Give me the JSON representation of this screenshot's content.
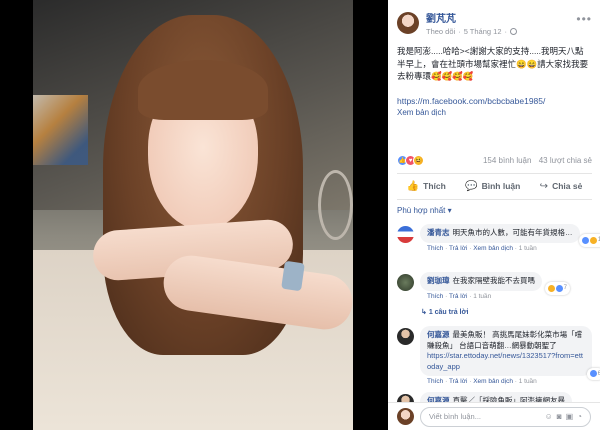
{
  "post": {
    "author": "劉芃芃",
    "follow": "Theo dõi",
    "date": "5 Tháng 12",
    "caption": "我是阿澎.....哈哈><謝謝大家的支持.....我明天八點半早上，會在社頭市場幫家裡忙😄😄請大家找我要去粉專環🥰🥰🥰🥰",
    "link": "https://m.facebook.com/bcbcbabe1985/",
    "see_translation": "Xem bản dịch",
    "comment_count": "154 bình luận",
    "share_count": "43 lượt chia sẻ"
  },
  "actions": {
    "like": "Thích",
    "comment": "Bình luận",
    "share": "Chia sẻ"
  },
  "filter": "Phù hợp nhất ▾",
  "comments": [
    {
      "name": "潘青志",
      "text": "明天魚市的人數，可能有年貨規格…",
      "like": "Thích",
      "reply": "Trả lời",
      "translate": "Xem bản dịch",
      "time": "1 tuần",
      "reactions": "12"
    },
    {
      "name": "劉珈瑋",
      "text": "在我家隔壁我能不去買嗎",
      "like": "Thích",
      "reply": "Trả lời",
      "time": "1 tuần",
      "reactions": "7",
      "replies": "1 câu trả lời"
    },
    {
      "name": "何嘉源",
      "text": "最美魚販！ 高挑馬尾妹彰化菜市場「嚐賺殺魚」 台語口音萌翻…網暴動朝聖了",
      "link": "https://star.ettoday.net/news/1323517?from=ettoday_app",
      "like": "Thích",
      "reply": "Trả lời",
      "translate": "Xem bản dịch",
      "time": "1 tuần",
      "reactions": "6"
    },
    {
      "name": "何嘉源",
      "text": "直擊／「採險魚販」阿澎擁網友暴"
    }
  ],
  "composer": {
    "placeholder": "Viết bình luận..."
  }
}
